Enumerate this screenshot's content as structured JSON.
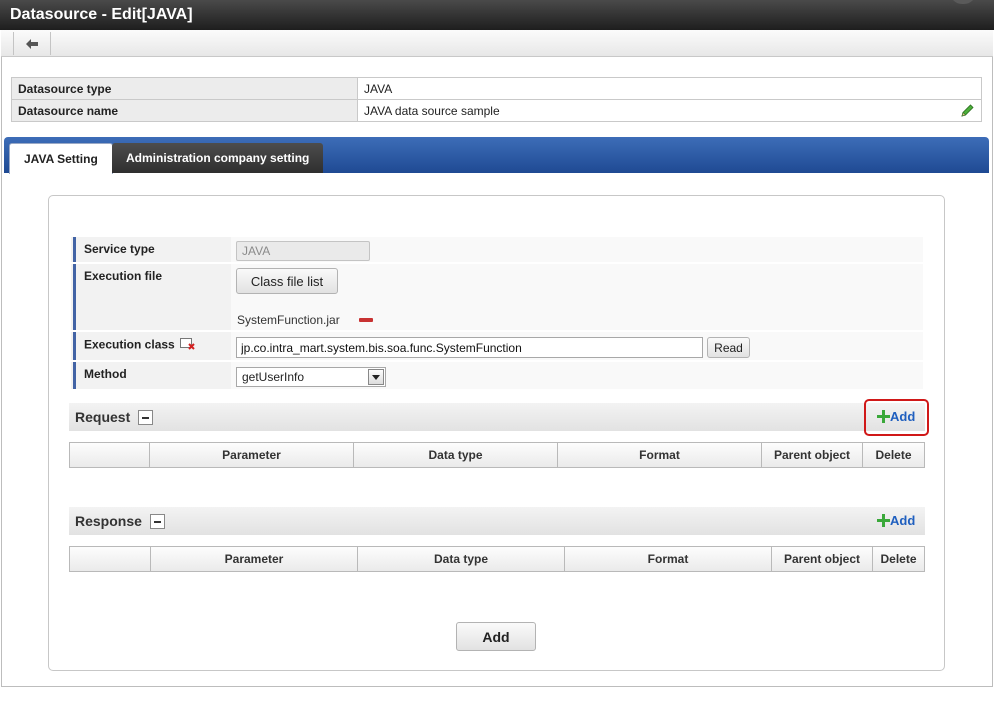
{
  "window": {
    "title": "Datasource - Edit[JAVA]"
  },
  "toolbar": {
    "back_icon": "arrow-left-icon"
  },
  "info": {
    "type_label": "Datasource type",
    "type_value": "JAVA",
    "name_label": "Datasource name",
    "name_value": "JAVA data source sample",
    "edit_icon": "pencil-icon"
  },
  "tabs": [
    {
      "label": "JAVA Setting",
      "active": true
    },
    {
      "label": "Administration company setting",
      "active": false
    }
  ],
  "form": {
    "service_type_label": "Service type",
    "service_type_value": "JAVA",
    "execution_file_label": "Execution file",
    "class_file_list_button": "Class file list",
    "execution_file_name": "SystemFunction.jar",
    "execution_class_label": "Execution class",
    "execution_class_value": "jp.co.intra_mart.system.bis.soa.func.SystemFunction",
    "read_button": "Read",
    "method_label": "Method",
    "method_value": "getUserInfo"
  },
  "request": {
    "title": "Request",
    "add_label": "Add",
    "columns": [
      "",
      "Parameter",
      "Data type",
      "Format",
      "Parent object",
      "Delete"
    ]
  },
  "response": {
    "title": "Response",
    "add_label": "Add",
    "columns": [
      "",
      "Parameter",
      "Data type",
      "Format",
      "Parent object",
      "Delete"
    ]
  },
  "footer": {
    "add_button": "Add"
  },
  "colors": {
    "title_bar": "#2b2b2b",
    "tab_bar": "#2a56a3",
    "highlight": "#d01818",
    "link": "#1f5fbf",
    "add_plus": "#3aa83a",
    "remove": "#c83232"
  }
}
